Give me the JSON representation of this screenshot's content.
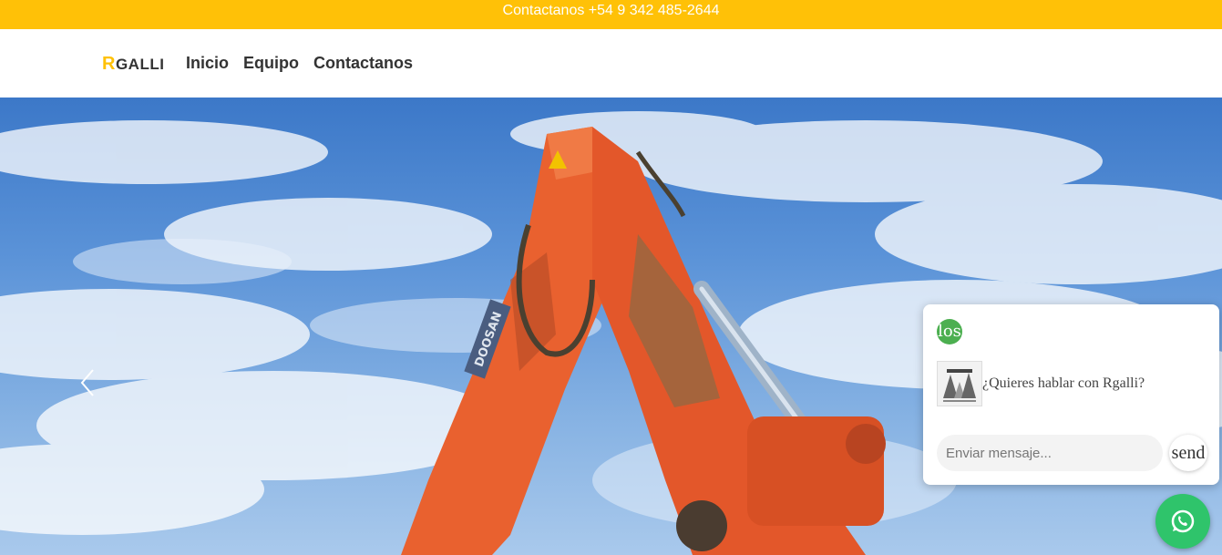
{
  "topbar": {
    "contact_text": "Contactanos +54 9 342 485-2644",
    "bg_color": "#ffc107"
  },
  "navbar": {
    "brand_initial": "R",
    "brand_rest": "GALLI",
    "links": [
      {
        "label": "Inicio"
      },
      {
        "label": "Equipo"
      },
      {
        "label": "Contactanos"
      }
    ]
  },
  "hero": {
    "prev_icon": "chevron-left-icon",
    "excavator_brand": "DOOSAN"
  },
  "chat": {
    "close_label": "los",
    "avatar_icon": "logo-image",
    "message": "¿Quieres hablar con Rgalli?",
    "input_placeholder": "Enviar mensaje...",
    "send_label": "send",
    "accent_color": "#4caf50"
  },
  "whatsapp": {
    "icon": "whatsapp-icon",
    "color": "#2fc46b"
  }
}
